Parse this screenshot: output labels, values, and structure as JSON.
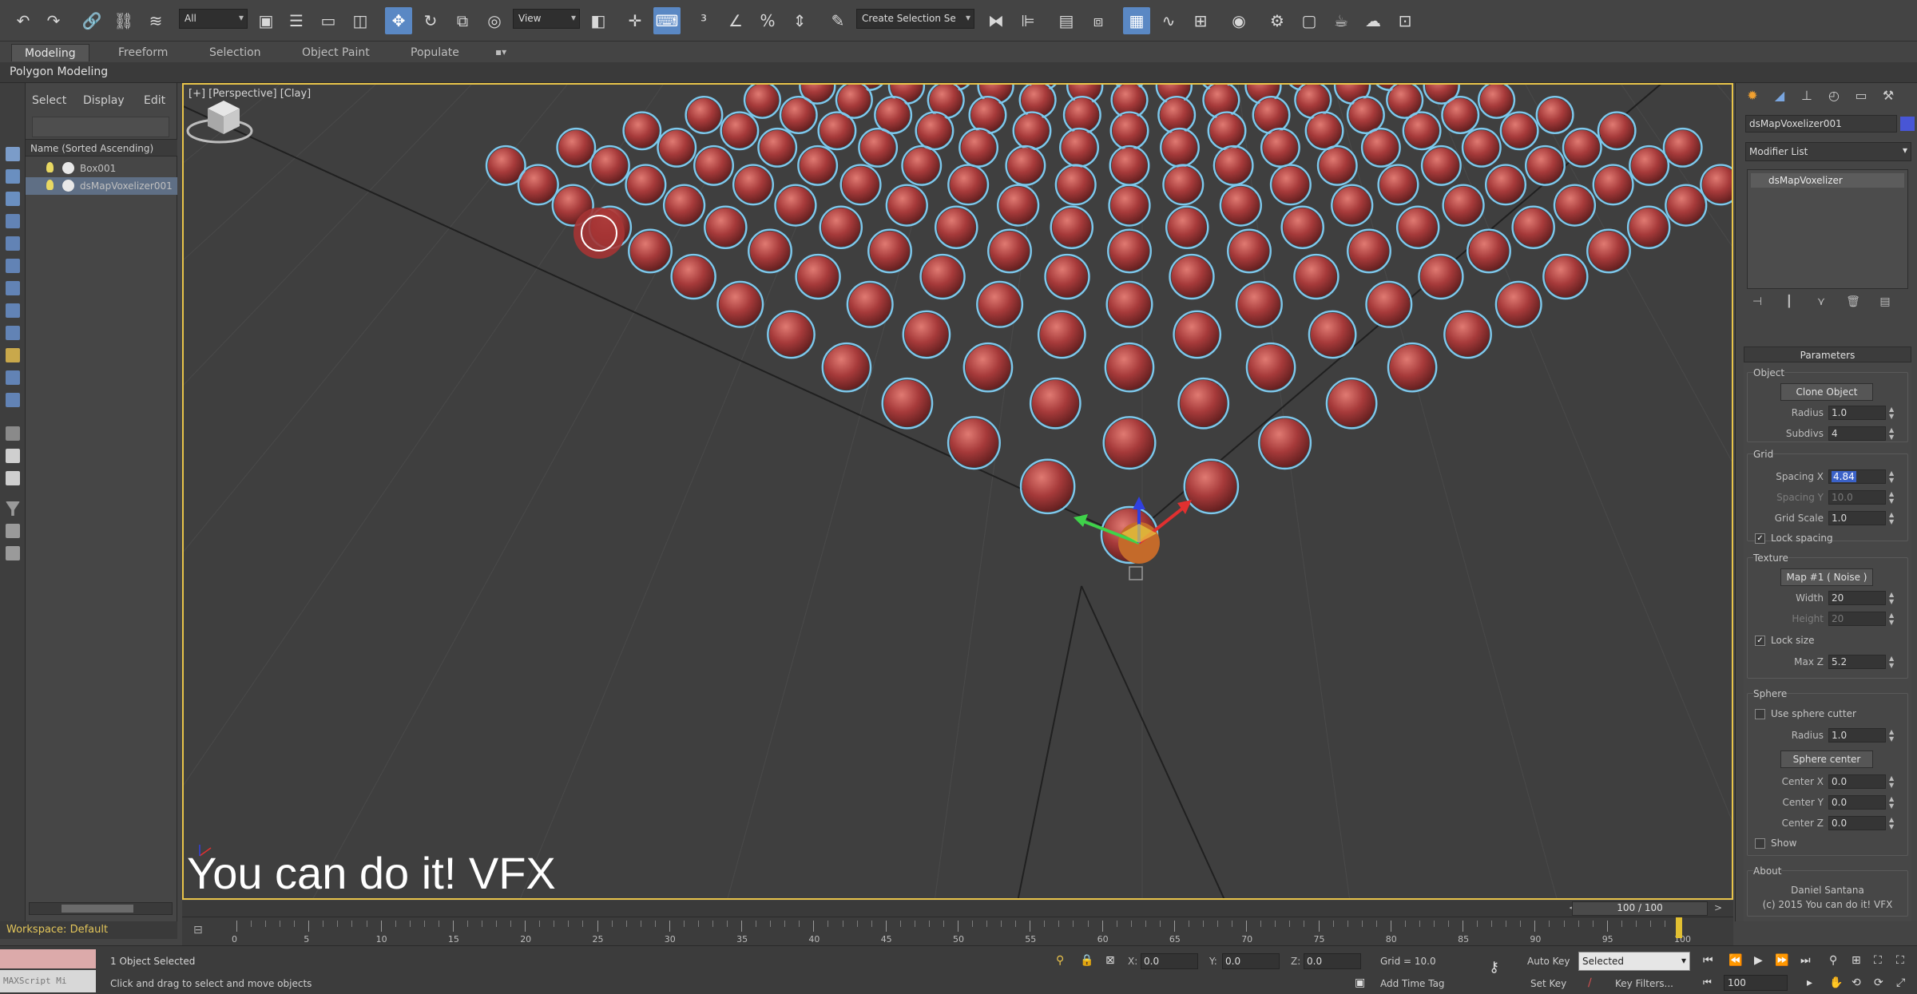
{
  "toolbar": {
    "selection_filter": "All",
    "ref_coord": "View",
    "named_selection": "Create Selection Se",
    "buttons": [
      "undo",
      "redo",
      "link",
      "unlink",
      "bind-space-warp",
      "select-object",
      "select-by-name",
      "rect-region",
      "window-crossing",
      "select-move",
      "select-rotate",
      "select-scale",
      "select-place",
      "use-pivot-center",
      "manipulate",
      "keyboard-shortcut",
      "snaps-3d",
      "angle-snap",
      "percent-snap",
      "spinner-snap",
      "edit-named-sets",
      "mirror",
      "align",
      "toggle-scene-explorer",
      "toggle-layer-explorer",
      "toggle-ribbon",
      "curve-editor",
      "schematic-view",
      "material-editor",
      "render-setup",
      "rendered-frame",
      "render",
      "render-online",
      "a360"
    ]
  },
  "ribbon": {
    "tabs": [
      "Modeling",
      "Freeform",
      "Selection",
      "Object Paint",
      "Populate"
    ],
    "active_tab": "Modeling",
    "panel_label": "Polygon Modeling"
  },
  "explorer": {
    "menus": [
      "Select",
      "Display",
      "Edit"
    ],
    "column_header": "Name (Sorted Ascending)",
    "items": [
      {
        "label": "Box001",
        "selected": false
      },
      {
        "label": "dsMapVoxelizer001",
        "selected": true
      }
    ]
  },
  "viewport": {
    "label": "[+] [Perspective] [Clay]",
    "watermark": "You can do it! VFX"
  },
  "command_panel": {
    "tabs": [
      "create",
      "modify",
      "hierarchy",
      "motion",
      "display",
      "utilities"
    ],
    "object_name": "dsMapVoxelizer001",
    "object_color": "#4856d6",
    "modifier_list_label": "Modifier List",
    "stack_item": "dsMapVoxelizer",
    "rollout_title": "Parameters",
    "object_group": {
      "title": "Object",
      "clone_button": "Clone Object",
      "radius_label": "Radius",
      "radius_value": "1.0",
      "subdivs_label": "Subdivs",
      "subdivs_value": "4"
    },
    "grid_group": {
      "title": "Grid",
      "spacing_x_label": "Spacing X",
      "spacing_x_value": "4.84",
      "spacing_y_label": "Spacing Y",
      "spacing_y_value": "10.0",
      "grid_scale_label": "Grid Scale",
      "grid_scale_value": "1.0",
      "lock_spacing_label": "Lock spacing",
      "lock_spacing_checked": true
    },
    "texture_group": {
      "title": "Texture",
      "map_button": "Map #1 ( Noise )",
      "width_label": "Width",
      "width_value": "20",
      "height_label": "Height",
      "height_value": "20",
      "lock_size_label": "Lock size",
      "lock_size_checked": true,
      "max_z_label": "Max Z",
      "max_z_value": "5.2"
    },
    "sphere_group": {
      "title": "Sphere",
      "use_cutter_label": "Use sphere cutter",
      "use_cutter_checked": false,
      "radius_label": "Radius",
      "radius_value": "1.0",
      "center_button": "Sphere center",
      "center_x_label": "Center X",
      "center_x_value": "0.0",
      "center_y_label": "Center Y",
      "center_y_value": "0.0",
      "center_z_label": "Center Z",
      "center_z_value": "0.0",
      "show_label": "Show",
      "show_checked": false
    },
    "about_group": {
      "title": "About",
      "author": "Daniel Santana",
      "copyright": "(c) 2015 You can do it! VFX"
    }
  },
  "timeline": {
    "workspace_label": "Workspace: Default",
    "frame_readout": "100 / 100",
    "current_frame": 100,
    "ticks": [
      0,
      5,
      10,
      15,
      20,
      25,
      30,
      35,
      40,
      45,
      50,
      55,
      60,
      65,
      70,
      75,
      80,
      85,
      90,
      95,
      100
    ]
  },
  "status": {
    "maxscript_label": "MAXScript Mi",
    "selection_text": "1 Object Selected",
    "prompt_text": "Click and drag to select and move objects",
    "x_label": "X:",
    "x_value": "0.0",
    "y_label": "Y:",
    "y_value": "0.0",
    "z_label": "Z:",
    "z_value": "0.0",
    "grid_text": "Grid = 10.0",
    "add_time_tag": "Add Time Tag",
    "auto_key": "Auto Key",
    "set_key": "Set Key",
    "key_mode": "Selected",
    "key_filters": "Key Filters...",
    "frame_field": "100"
  },
  "colors": {
    "accent_yellow": "#e8c44a",
    "sphere_red": "#a63a3a",
    "sphere_outline": "#7ec8ec",
    "active_blue": "#5a88c4"
  }
}
